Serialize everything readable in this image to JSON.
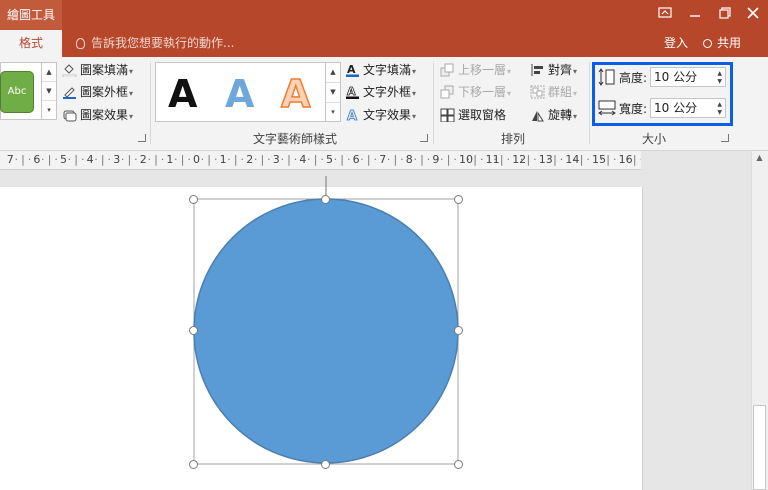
{
  "titlebar": {
    "context_tab": "繪圖工具",
    "buttons": [
      "present-icon",
      "restore-icon",
      "close-icon"
    ]
  },
  "tabs": {
    "active": "格式",
    "tell_me": "告訴我您想要執行的動作...",
    "login": "登入",
    "share": "共用"
  },
  "ribbon": {
    "shape_styles": {
      "preview_text": "Abc",
      "fill": "圖案填滿",
      "outline": "圖案外框",
      "effects": "圖案效果"
    },
    "wordart": {
      "samples": [
        {
          "letter": "A",
          "style": "solid-black"
        },
        {
          "letter": "A",
          "style": "blue-gradient"
        },
        {
          "letter": "A",
          "style": "orange-outline"
        }
      ],
      "text_fill": "文字填滿",
      "text_outline": "文字外框",
      "text_effects": "文字效果",
      "group_label": "文字藝術師樣式"
    },
    "arrange": {
      "bring_forward": "上移一層",
      "send_backward": "下移一層",
      "selection_pane": "選取窗格",
      "align": "對齊",
      "group": "群組",
      "rotate": "旋轉",
      "group_label": "排列"
    },
    "size": {
      "height_label": "高度:",
      "height_value": "10 公分",
      "width_label": "寬度:",
      "width_value": "10 公分",
      "group_label": "大小"
    }
  },
  "ruler": {
    "labels": [
      "7",
      "6",
      "5",
      "4",
      "3",
      "2",
      "1",
      "0",
      "1",
      "2",
      "3",
      "4",
      "5",
      "6",
      "7",
      "8",
      "9",
      "10",
      "11",
      "12",
      "13",
      "14",
      "15",
      "16"
    ]
  },
  "colors": {
    "accent": "#b7472a",
    "shape_fill": "#5b9bd5",
    "shape_outline": "#4a7fb0",
    "highlight": "#0a5fe8"
  }
}
